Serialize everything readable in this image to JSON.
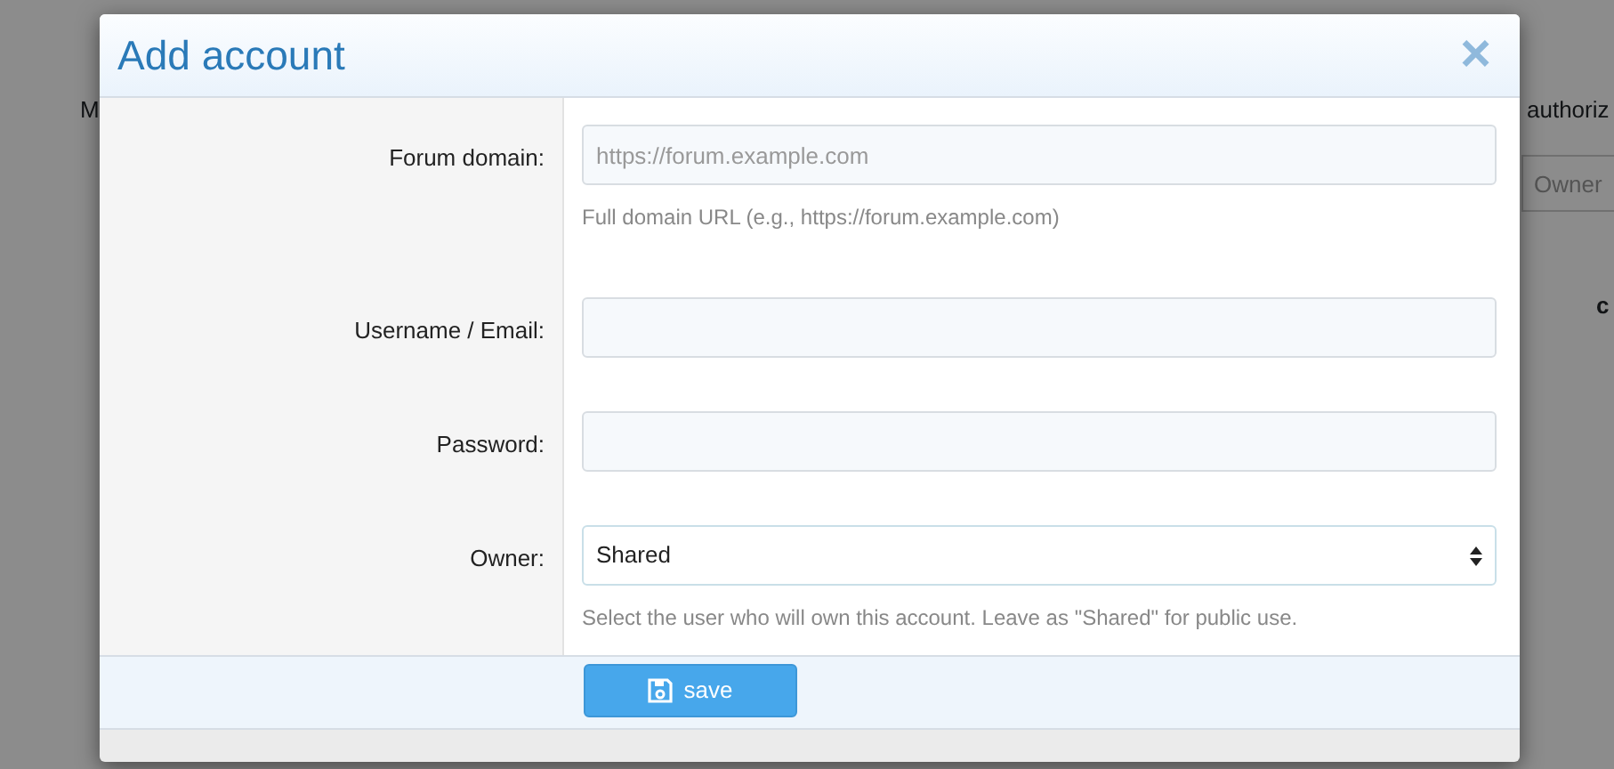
{
  "background_page": {
    "description_start": "M",
    "description_end": "authoriz",
    "owner_filter": {
      "placeholder": "Owner"
    },
    "column_header": "c"
  },
  "dialog": {
    "title": "Add account",
    "close": "×",
    "fields": [
      {
        "label": "Forum domain:",
        "kind": "text",
        "placeholder": "https://forum.example.com",
        "help": "Full domain URL (e.g., https://forum.example.com)"
      },
      {
        "label": "Username / Email:",
        "kind": "text"
      },
      {
        "label": "Password:",
        "kind": "password"
      },
      {
        "label": "Owner:",
        "kind": "select",
        "value": "Shared",
        "help": "Select the user who will own this account. Leave as \"Shared\" for public use."
      }
    ],
    "save_button": "save"
  }
}
